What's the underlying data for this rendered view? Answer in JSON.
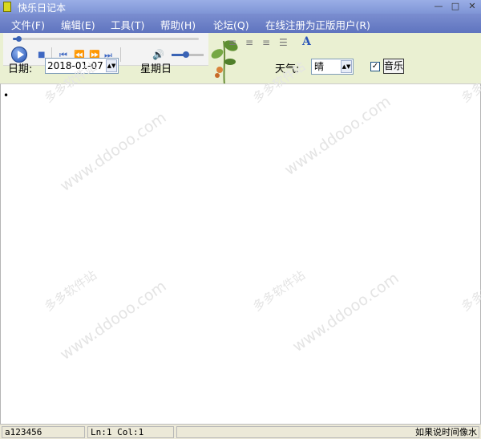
{
  "window": {
    "title": "快乐日记本"
  },
  "menu": {
    "items": [
      "文件(F)",
      "编辑(E)",
      "工具(T)",
      "帮助(H)",
      "论坛(Q)",
      "在线注册为正版用户(R)"
    ]
  },
  "player": {
    "progress": 0.03,
    "volume": 0.45
  },
  "toolbar": {
    "date_label": "日期:",
    "date_value": "2018-01-07",
    "weekday": "星期日",
    "weather_label": "天气:",
    "weather_value": "晴",
    "music_checked": true,
    "music_label": "音乐",
    "font_icon_glyph": "A"
  },
  "editor": {
    "content": "•"
  },
  "watermark": {
    "text": "www.ddooo.com",
    "text_cn": "多多软件站"
  },
  "statusbar": {
    "user": "a123456",
    "position": "Ln:1 Col:1",
    "message": "如果说时间像水"
  },
  "colors": {
    "menubar": "#6a7fc8",
    "toolbar_bg": "#eaf0d2",
    "accent": "#3a63b5"
  }
}
